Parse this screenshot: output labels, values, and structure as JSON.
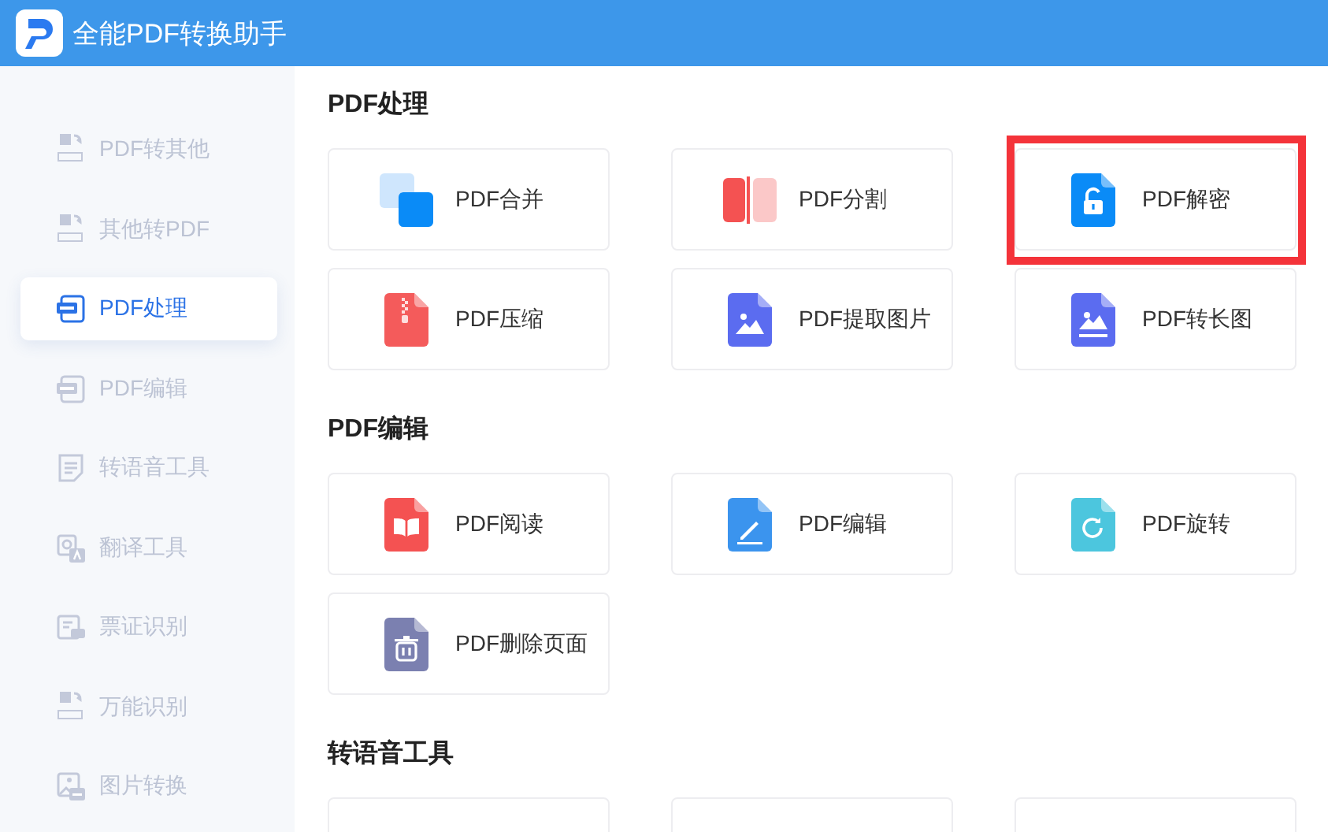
{
  "window": {
    "title": "全能PDF转换助手"
  },
  "sidebar": {
    "items": [
      {
        "label": "PDF转其他",
        "kind": "convert",
        "selected": false
      },
      {
        "label": "其他转PDF",
        "kind": "convert",
        "selected": false
      },
      {
        "label": "PDF处理",
        "kind": "pdf",
        "selected": true
      },
      {
        "label": "PDF编辑",
        "kind": "pdf",
        "selected": false
      },
      {
        "label": "转语音工具",
        "kind": "note",
        "selected": false
      },
      {
        "label": "翻译工具",
        "kind": "translate",
        "selected": false
      },
      {
        "label": "票证识别",
        "kind": "ticket",
        "selected": false
      },
      {
        "label": "万能识别",
        "kind": "convert",
        "selected": false
      },
      {
        "label": "图片转换",
        "kind": "picture",
        "selected": false
      }
    ]
  },
  "sections": [
    {
      "title": "PDF处理",
      "tools": [
        {
          "label": "PDF合并",
          "kind": "merge",
          "highlighted": false
        },
        {
          "label": "PDF分割",
          "kind": "split",
          "highlighted": false
        },
        {
          "label": "PDF解密",
          "kind": "unlock",
          "highlighted": true
        },
        {
          "label": "PDF压缩",
          "kind": "compress",
          "highlighted": false
        },
        {
          "label": "PDF提取图片",
          "kind": "image",
          "highlighted": false
        },
        {
          "label": "PDF转长图",
          "kind": "long-image",
          "highlighted": false
        }
      ]
    },
    {
      "title": "PDF编辑",
      "tools": [
        {
          "label": "PDF阅读",
          "kind": "read",
          "highlighted": false
        },
        {
          "label": "PDF编辑",
          "kind": "edit",
          "highlighted": false
        },
        {
          "label": "PDF旋转",
          "kind": "rotate",
          "highlighted": false
        },
        {
          "label": "PDF删除页面",
          "kind": "delete",
          "highlighted": false
        }
      ]
    },
    {
      "title": "转语音工具",
      "tools": [
        {
          "kind": "hidden",
          "highlighted": false
        },
        {
          "kind": "hidden",
          "highlighted": false
        },
        {
          "kind": "hidden",
          "highlighted": false
        }
      ]
    }
  ]
}
